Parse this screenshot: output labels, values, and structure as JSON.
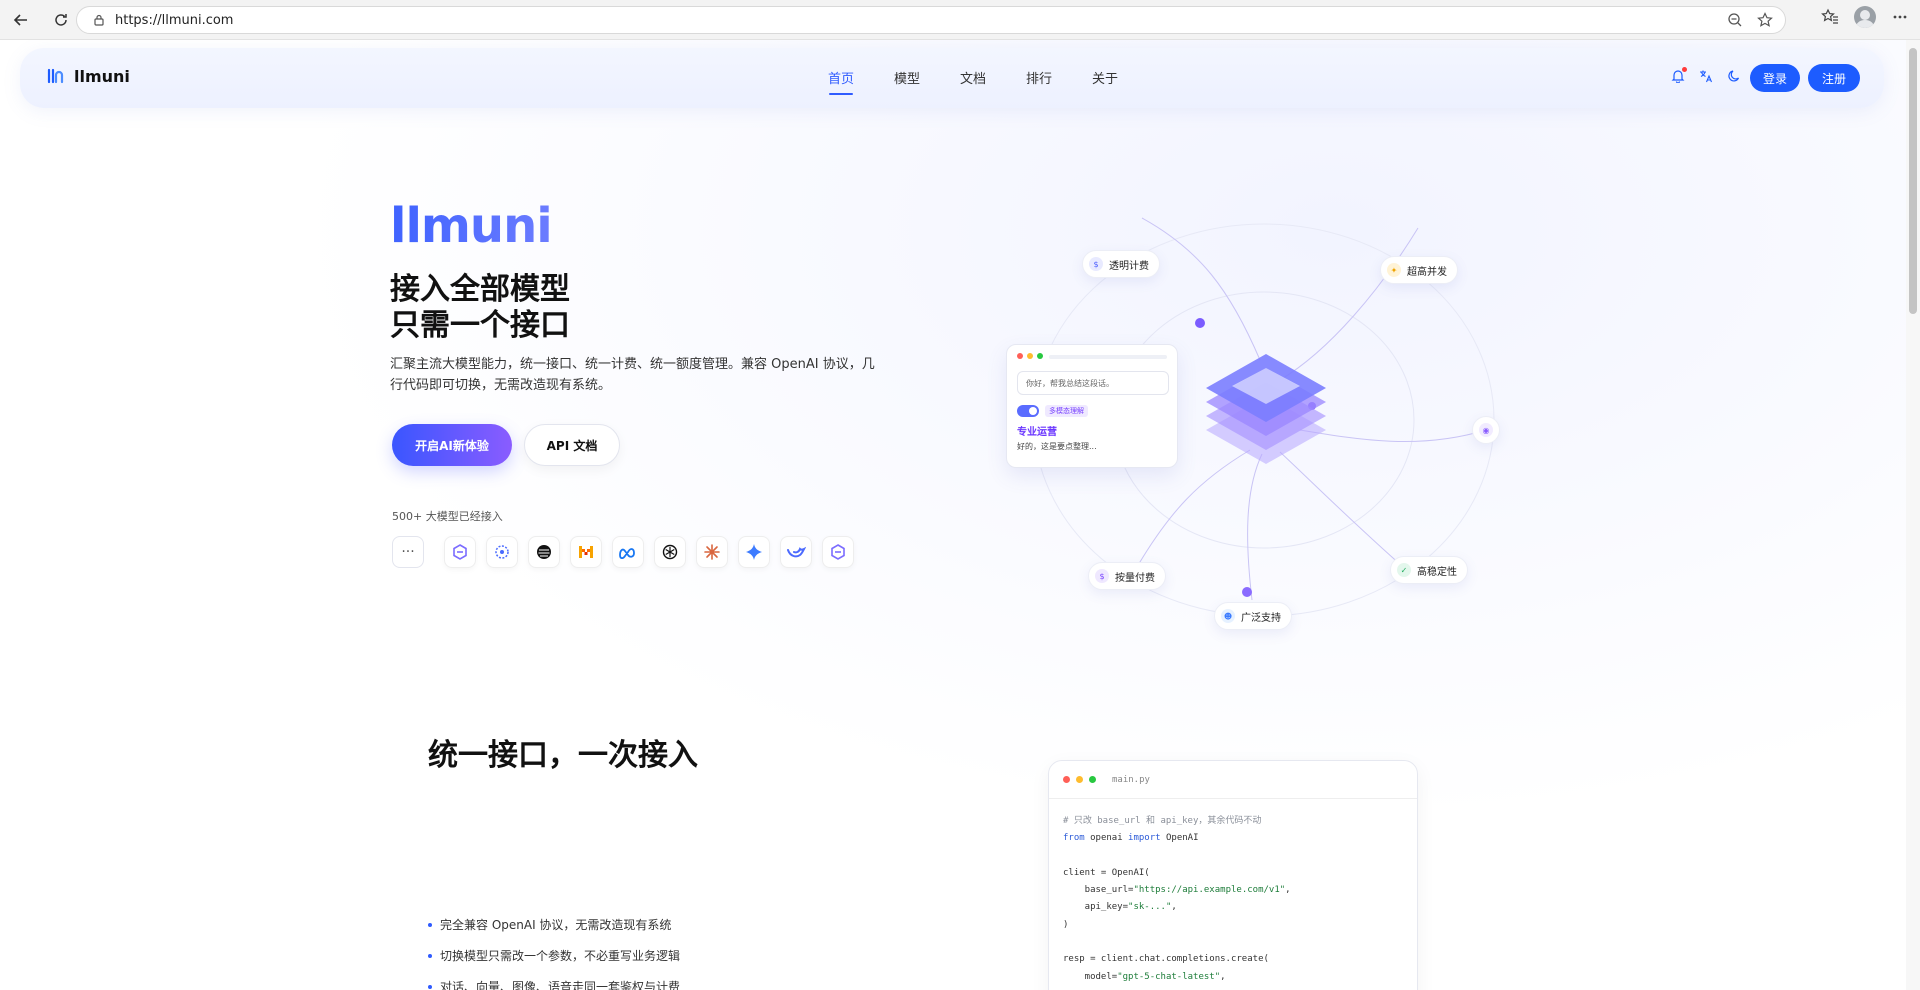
{
  "browser": {
    "url": "https://llmuni.com"
  },
  "nav": {
    "brand": "llmuni",
    "items": [
      {
        "label": "首页",
        "active": true
      },
      {
        "label": "模型",
        "active": false
      },
      {
        "label": "文档",
        "active": false
      },
      {
        "label": "排行",
        "active": false
      },
      {
        "label": "关于",
        "active": false
      }
    ],
    "login_label": "登录",
    "register_label": "注册",
    "accent_color": "#1d5cff"
  },
  "hero": {
    "title": "llmuni",
    "line1": "接入全部模型",
    "line2": "只需一个接口",
    "description": "汇聚主流大模型能力，统一接口、统一计费、统一额度管理。兼容 OpenAI 协议，几行代码即可切换，无需改造现有系统。",
    "cta_primary": "开启AI新体验",
    "cta_secondary": "API 文档",
    "model_count": "500+ 大模型已经接入",
    "more_icon": "···",
    "logos": [
      "qwen-icon",
      "cohere-icon",
      "stability-icon",
      "mistral-icon",
      "meta-icon",
      "openai-icon",
      "claude-icon",
      "gemini-icon",
      "deepseek-icon",
      "qwen-icon"
    ]
  },
  "orbit": {
    "chips": {
      "transparent_billing": "透明计费",
      "high_concurrency": "超高并发",
      "pay_as_you_go": "按量付费",
      "broad_support": "广泛支持",
      "high_stability": "高稳定性"
    },
    "mini_window": {
      "input_text": "你好，帮我总结这段话。",
      "tag": "多模态理解",
      "pro_label": "专业运营",
      "reply_text": "好的，这是要点整理..."
    }
  },
  "section2": {
    "title": "统一接口，一次接入",
    "features": [
      "完全兼容 OpenAI 协议，无需改造现有系统",
      "切换模型只需改一个参数，不必重写业务逻辑",
      "对话、向量、图像、语音走同一套鉴权与计费"
    ]
  },
  "code": {
    "filename": "main.py",
    "lines": {
      "comment": "# 只改 base_url 和 api_key，其余代码不动",
      "import_from": "from",
      "import_mod": " openai ",
      "import_kw": "import",
      "import_name": " OpenAI",
      "client_open": "client = OpenAI(",
      "base_url_key": "    base_url=",
      "base_url_val": "\"https://api.example.com/v1\"",
      "api_key_key": "    api_key=",
      "api_key_val": "\"sk-...\"",
      "close": ")",
      "resp": "resp = client.chat.completions.create(",
      "model_key": "    model=",
      "model_val": "\"gpt-5-chat-latest\""
    }
  }
}
